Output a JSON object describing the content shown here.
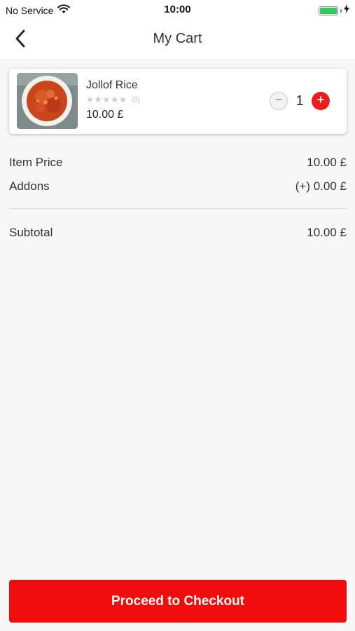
{
  "status_bar": {
    "carrier": "No Service",
    "time": "10:00",
    "battery_level": 1.0
  },
  "nav": {
    "title": "My Cart",
    "back_icon": "chevron-left-icon"
  },
  "cart": {
    "items": [
      {
        "name": "Jollof Rice",
        "rating_stars": 5,
        "rating_value": 0,
        "rating_count": "(0)",
        "price": "10.00 £",
        "quantity": "1",
        "image_icon": "jollof-rice-photo"
      }
    ]
  },
  "summary": {
    "item_price_label": "Item Price",
    "item_price_value": "10.00 £",
    "addons_label": "Addons",
    "addons_value": "(+) 0.00 £",
    "subtotal_label": "Subtotal",
    "subtotal_value": "10.00 £"
  },
  "checkout": {
    "button_label": "Proceed to Checkout"
  },
  "colors": {
    "accent": "#f20d0d",
    "battery": "#34c759",
    "star_empty": "#c8c8c8"
  }
}
